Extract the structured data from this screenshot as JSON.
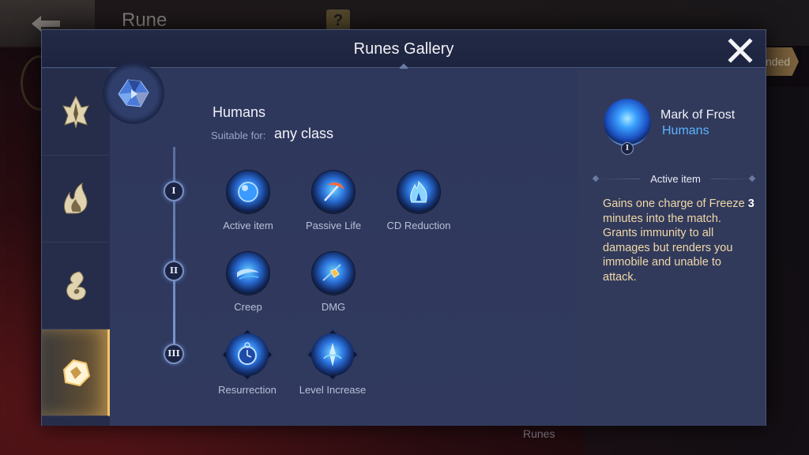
{
  "background": {
    "title": "Rune",
    "help_label": "?",
    "tag_label": "nded",
    "bottom_label": "Runes"
  },
  "modal": {
    "title": "Runes Gallery",
    "close_icon": "close-x"
  },
  "sidebar": {
    "tabs": [
      {
        "icon": "spiky-leaf-icon",
        "active": false
      },
      {
        "icon": "flame-icon",
        "active": false
      },
      {
        "icon": "swirl-icon",
        "active": false
      },
      {
        "icon": "crystal-icon",
        "active": true
      }
    ]
  },
  "faction": {
    "name": "Humans",
    "suitable_label": "Suitable for:",
    "suitable_value": "any class"
  },
  "tiers": [
    {
      "numeral": "I",
      "runes": [
        "Active item",
        "Passive Life",
        "CD Reduction"
      ]
    },
    {
      "numeral": "II",
      "runes": [
        "Creep",
        "DMG"
      ]
    },
    {
      "numeral": "III",
      "runes": [
        "Resurrection",
        "Level Increase"
      ]
    }
  ],
  "selected": {
    "name": "Mark of Frost",
    "faction": "Humans",
    "tier": "I",
    "category": "Active item",
    "desc_part1": "Gains one charge of Freeze ",
    "desc_num": "3",
    "desc_part2": " minutes into the match. Grants immunity to all damages but renders you immobile and unable to attack."
  },
  "colors": {
    "accent_gold": "#f2c56a",
    "faction_blue": "#5ab4ff",
    "desc_text": "#f0d9a8"
  }
}
